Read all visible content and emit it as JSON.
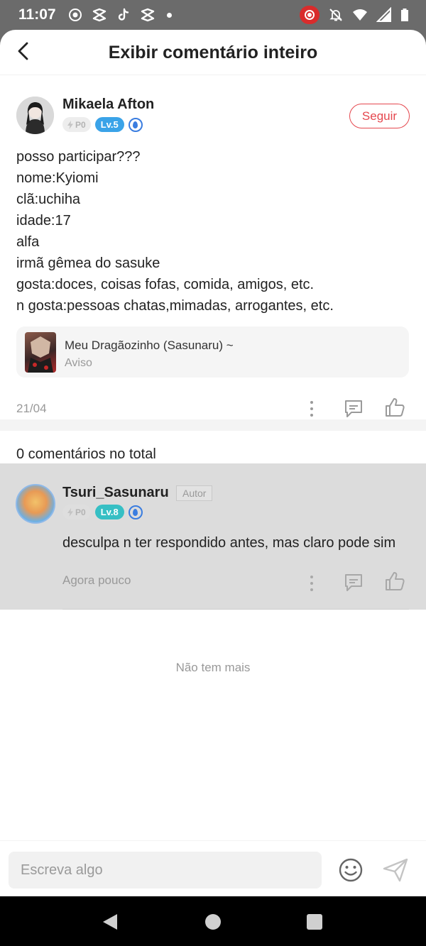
{
  "status_bar": {
    "time": "11:07",
    "left_icons": [
      "radio-icon",
      "app-logo-icon",
      "tiktok-icon",
      "app-logo-icon",
      "notification-dot-icon"
    ],
    "right_icons": [
      "screen-record-icon",
      "bell-muted-icon",
      "wifi-icon",
      "signal-icon",
      "battery-icon"
    ]
  },
  "header": {
    "title": "Exibir comentário inteiro",
    "back_icon": "chevron-left-icon"
  },
  "comment": {
    "username": "Mikaela Afton",
    "badges": {
      "points": "P0",
      "level": "Lv.5"
    },
    "follow_label": "Seguir",
    "lines": [
      "posso participar???",
      "nome:Kyiomi",
      "clã:uchiha",
      "idade:17",
      "alfa",
      "irmã gêmea do sasuke",
      "gosta:doces, coisas fofas, comida, amigos, etc.",
      "n gosta:pessoas chatas,mimadas, arrogantes, etc."
    ],
    "reference": {
      "title": "Meu Dragãozinho (Sasunaru) ~",
      "subtitle": "Aviso"
    },
    "date": "21/04"
  },
  "replies_count": "0 comentários no total",
  "reply": {
    "username": "Tsuri_Sasunaru",
    "author_tag": "Autor",
    "badges": {
      "points": "P0",
      "level": "Lv.8"
    },
    "text": "desculpa n ter respondido antes, mas claro pode sim",
    "date": "Agora pouco"
  },
  "end_text": "Não tem mais",
  "composer": {
    "placeholder": "Escreva algo"
  },
  "colors": {
    "accent_red": "#e5474e",
    "level_blue": "#3aa3e8",
    "level_teal": "#36bfc4",
    "muted_text": "#999999"
  }
}
